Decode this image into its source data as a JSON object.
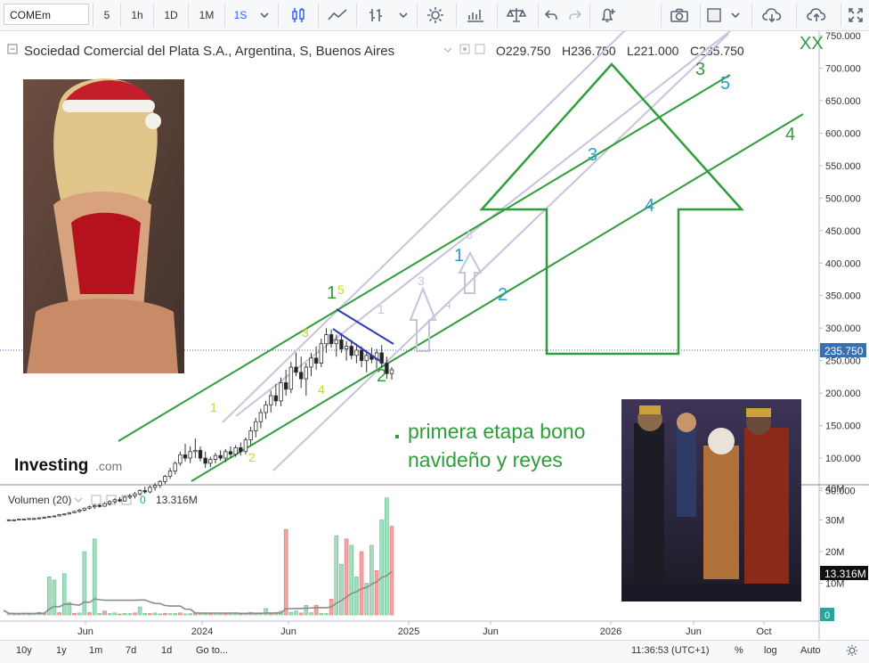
{
  "toolbar": {
    "symbol": "COMEm",
    "intervals": [
      "5",
      "1h",
      "1D",
      "1M",
      "1S"
    ],
    "active_interval": "1S"
  },
  "legend": {
    "title": "Sociedad Comercial del Plata S.A., Argentina, S, Buenos Aires",
    "open": "O229.750",
    "high": "H236.750",
    "low": "L221.000",
    "close": "C235.750"
  },
  "volume_legend": {
    "name": "Volumen (20)",
    "zero": "0",
    "value": "13.316M"
  },
  "price_axis": {
    "ticks": [
      "750.000",
      "700.000",
      "650.000",
      "600.000",
      "550.000",
      "500.000",
      "450.000",
      "400.000",
      "350.000",
      "300.000",
      "250.000",
      "200.000",
      "150.000",
      "100.000",
      "50.000"
    ],
    "last_price": "235.750",
    "colors": {
      "axis_text": "#333333",
      "last_price_bg": "#3a6fb0"
    }
  },
  "volume_axis": {
    "ticks": [
      "40M",
      "30M",
      "20M",
      "10M"
    ],
    "last_value": "13.316M",
    "zero_badge": "0"
  },
  "time_axis": [
    "Jun",
    "2024",
    "Jun",
    "2025",
    "Jun",
    "2026",
    "Jun",
    "Oct"
  ],
  "annotations": {
    "watermark": "Investing",
    "watermark_suffix": ".com",
    "top_right_mark": "XX",
    "note_line1": "primera etapa bono",
    "note_line2": "navideño y reyes",
    "wave_labels": [
      {
        "t": "1",
        "c": "#c8d62a"
      },
      {
        "t": "2",
        "c": "#c8d62a"
      },
      {
        "t": "3",
        "c": "#c8d62a"
      },
      {
        "t": "4",
        "c": "#c8d62a"
      },
      {
        "t": "5",
        "c": "#c8d62a"
      },
      {
        "t": "1",
        "c": "#2e9e3a"
      },
      {
        "t": "2",
        "c": "#2e9e3a"
      },
      {
        "t": "3",
        "c": "#2e9e3a"
      },
      {
        "t": "4",
        "c": "#2e9e3a"
      },
      {
        "t": "1",
        "c": "#c6c3dc"
      },
      {
        "t": "3",
        "c": "#c6c3dc"
      },
      {
        "t": "4",
        "c": "#c6c3dc"
      },
      {
        "t": "5",
        "c": "#c6c3dc"
      },
      {
        "t": "1",
        "c": "#2a9fd8"
      },
      {
        "t": "2",
        "c": "#2a9fd8"
      },
      {
        "t": "3",
        "c": "#2a9fd8"
      },
      {
        "t": "4",
        "c": "#2a9fd8"
      },
      {
        "t": "5",
        "c": "#2a9fd8"
      }
    ]
  },
  "bottombar": {
    "ranges": [
      "10y",
      "1y",
      "1m",
      "7d",
      "1d"
    ],
    "goto": "Go to...",
    "clock": "11:36:53 (UTC+1)",
    "percent": "%",
    "log": "log",
    "auto": "Auto"
  },
  "chart_data": {
    "type": "candlestick",
    "title": "Sociedad Comercial del Plata S.A., Argentina, S, Buenos Aires",
    "ylim": [
      0,
      750
    ],
    "x_labels": [
      "Jun",
      "2024",
      "Jun",
      "2025",
      "Jun",
      "2026",
      "Jun",
      "Oct"
    ],
    "ohlc": [
      [
        5,
        6,
        4,
        5
      ],
      [
        5,
        6,
        4,
        5
      ],
      [
        5,
        6,
        4,
        6
      ],
      [
        6,
        7,
        5,
        6
      ],
      [
        6,
        7,
        5,
        7
      ],
      [
        7,
        8,
        6,
        7
      ],
      [
        7,
        9,
        6,
        8
      ],
      [
        8,
        10,
        7,
        9
      ],
      [
        9,
        11,
        8,
        10
      ],
      [
        10,
        12,
        9,
        11
      ],
      [
        11,
        14,
        10,
        13
      ],
      [
        13,
        15,
        12,
        14
      ],
      [
        14,
        17,
        13,
        16
      ],
      [
        16,
        19,
        15,
        18
      ],
      [
        18,
        22,
        16,
        20
      ],
      [
        20,
        24,
        18,
        23
      ],
      [
        23,
        27,
        21,
        25
      ],
      [
        25,
        29,
        22,
        27
      ],
      [
        27,
        30,
        24,
        26
      ],
      [
        26,
        32,
        25,
        30
      ],
      [
        30,
        35,
        27,
        33
      ],
      [
        33,
        38,
        30,
        36
      ],
      [
        36,
        40,
        32,
        34
      ],
      [
        34,
        42,
        33,
        40
      ],
      [
        40,
        45,
        37,
        42
      ],
      [
        42,
        48,
        38,
        45
      ],
      [
        45,
        52,
        42,
        50
      ],
      [
        50,
        56,
        45,
        48
      ],
      [
        48,
        58,
        46,
        55
      ],
      [
        55,
        62,
        50,
        58
      ],
      [
        58,
        66,
        54,
        64
      ],
      [
        64,
        74,
        60,
        72
      ],
      [
        72,
        85,
        68,
        80
      ],
      [
        80,
        95,
        75,
        92
      ],
      [
        92,
        110,
        88,
        105
      ],
      [
        105,
        122,
        95,
        100
      ],
      [
        100,
        118,
        92,
        110
      ],
      [
        110,
        130,
        100,
        112
      ],
      [
        112,
        118,
        95,
        100
      ],
      [
        100,
        110,
        85,
        92
      ],
      [
        92,
        102,
        86,
        98
      ],
      [
        98,
        108,
        92,
        104
      ],
      [
        104,
        112,
        96,
        100
      ],
      [
        100,
        114,
        94,
        110
      ],
      [
        110,
        118,
        100,
        106
      ],
      [
        106,
        120,
        102,
        116
      ],
      [
        116,
        124,
        104,
        110
      ],
      [
        110,
        132,
        106,
        128
      ],
      [
        128,
        148,
        120,
        142
      ],
      [
        142,
        162,
        132,
        156
      ],
      [
        156,
        176,
        146,
        170
      ],
      [
        170,
        188,
        160,
        182
      ],
      [
        182,
        204,
        170,
        196
      ],
      [
        196,
        214,
        180,
        188
      ],
      [
        188,
        224,
        180,
        216
      ],
      [
        216,
        236,
        196,
        206
      ],
      [
        206,
        248,
        200,
        240
      ],
      [
        240,
        262,
        226,
        232
      ],
      [
        232,
        256,
        208,
        222
      ],
      [
        222,
        246,
        196,
        240
      ],
      [
        240,
        262,
        226,
        254
      ],
      [
        254,
        272,
        236,
        246
      ],
      [
        246,
        284,
        240,
        276
      ],
      [
        276,
        300,
        262,
        290
      ],
      [
        290,
        298,
        270,
        276
      ],
      [
        276,
        290,
        256,
        282
      ],
      [
        282,
        292,
        262,
        268
      ],
      [
        268,
        280,
        250,
        272
      ],
      [
        272,
        282,
        252,
        258
      ],
      [
        258,
        276,
        246,
        266
      ],
      [
        266,
        272,
        240,
        250
      ],
      [
        250,
        266,
        232,
        258
      ],
      [
        258,
        270,
        246,
        252
      ],
      [
        252,
        268,
        238,
        262
      ],
      [
        262,
        274,
        240,
        246
      ],
      [
        246,
        256,
        222,
        230
      ],
      [
        230,
        240,
        221,
        236
      ]
    ],
    "volume_millions": [
      0.5,
      0.4,
      0.3,
      0.6,
      0.4,
      0.5,
      0.8,
      0.6,
      12,
      11,
      0.7,
      13,
      4,
      0.5,
      0.6,
      20,
      0.7,
      24,
      0.5,
      1.2,
      0.4,
      0.6,
      0.3,
      0.5,
      0.4,
      0.6,
      2.5,
      0.5,
      0.4,
      0.6,
      0.3,
      0.5,
      0.4,
      0.5,
      0.6,
      0.3,
      0.4,
      0.6,
      0.5,
      0.4,
      0.3,
      0.5,
      0.6,
      0.4,
      0.5,
      0.7,
      0.6,
      0.4,
      0.8,
      0.6,
      0.5,
      2,
      0.5,
      0.8,
      1.2,
      27,
      0.8,
      1.2,
      0.6,
      3,
      0.7,
      3,
      0.5,
      0.4,
      5,
      25,
      16,
      24,
      22,
      12,
      20,
      10,
      22,
      14,
      30,
      37,
      28
    ]
  }
}
